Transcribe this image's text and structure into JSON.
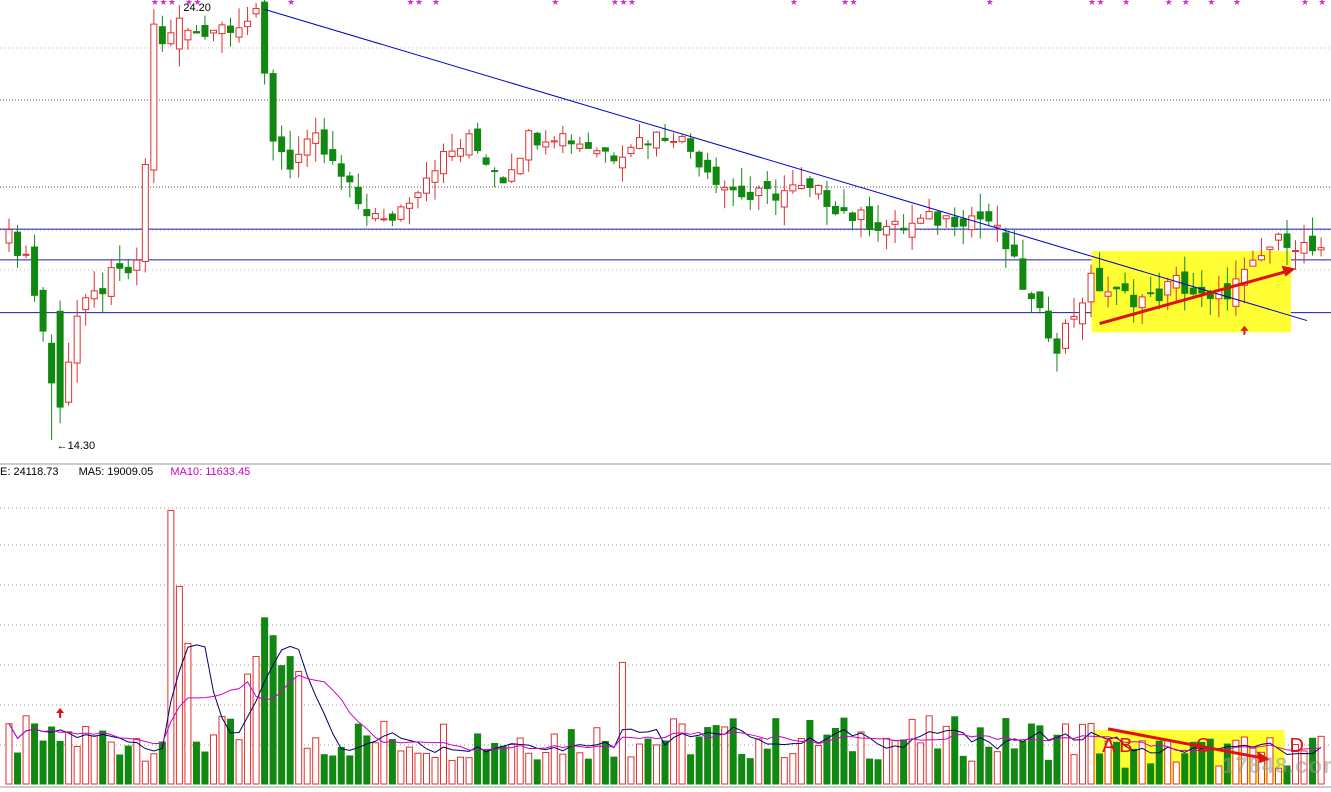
{
  "chart_data": [
    {
      "type": "candlestick",
      "title": "",
      "ylim": [
        13.5,
        24.5
      ],
      "high_label": "24.20",
      "low_label": "14.30",
      "colors": {
        "up": "#e03030",
        "down": "#118811",
        "trendline": "#0000cc",
        "support": "#1a1ab0",
        "highlight": "#ffff33",
        "arrow": "#e01010",
        "signal_star": "#cc33cc"
      },
      "support_lines": [
        19.1,
        18.4,
        17.2
      ],
      "trendline": [
        {
          "i": 30,
          "price": 24.1
        },
        {
          "i": 150,
          "price": 17.2
        }
      ],
      "highlight_range": {
        "from": 128,
        "to": 150,
        "low": 16.75,
        "high": 18.6
      },
      "uptrend_arrow": [
        {
          "i": 128,
          "price": 16.95
        },
        {
          "i": 151,
          "price": 18.2
        }
      ],
      "up_arrows": [
        145
      ],
      "signal_marks": [
        17,
        18,
        19,
        21,
        22,
        33,
        47,
        48,
        50,
        64,
        71,
        72,
        73,
        92,
        98,
        99,
        115,
        127,
        128,
        131,
        136,
        138,
        141,
        144,
        152,
        154
      ]
    },
    {
      "type": "bar",
      "title": "",
      "legend": [
        {
          "text": "E: 24118.73",
          "color": "#000000"
        },
        {
          "text": "MA5: 19009.05",
          "color": "#000000"
        },
        {
          "text": "MA10: 11633.45",
          "color": "#cc00cc"
        }
      ],
      "ylim": [
        0,
        80000
      ],
      "colors": {
        "up": "#e03030",
        "down": "#118811",
        "ma5": "#000066",
        "ma10": "#cc00cc",
        "highlight": "#ffff33",
        "arrow": "#e01010"
      },
      "letters": [
        {
          "text": "A",
          "i": 129
        },
        {
          "text": "B",
          "i": 131
        },
        {
          "text": "C",
          "i": 140
        },
        {
          "text": "D",
          "i": 151
        }
      ],
      "highlight_range": {
        "from": 128,
        "to": 149
      },
      "down_arrow": [
        {
          "i": 129,
          "v": 14500
        },
        {
          "i": 148,
          "v": 6500
        }
      ],
      "up_arrows": [
        6
      ]
    }
  ]
}
